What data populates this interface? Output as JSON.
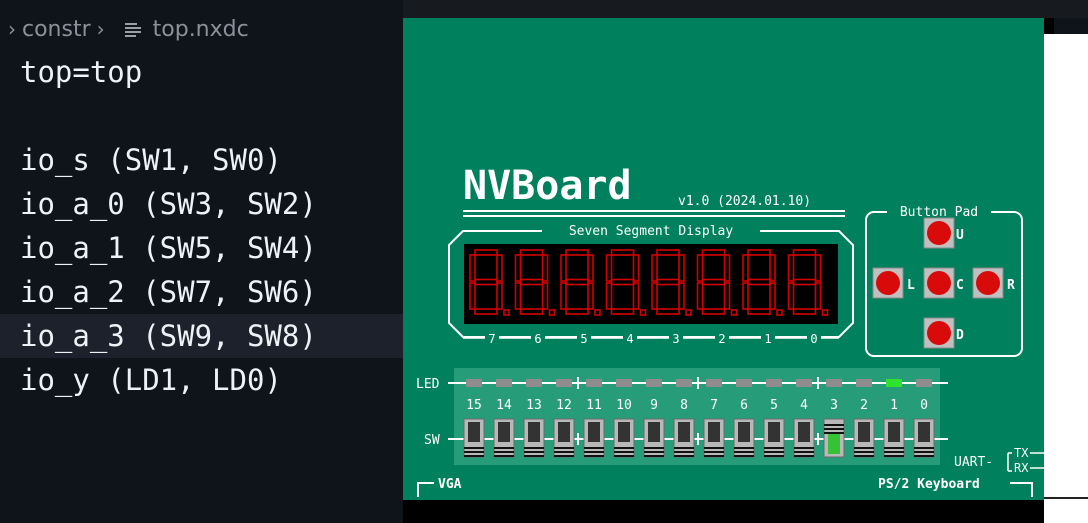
{
  "editor": {
    "breadcrumb": {
      "folder": "constr",
      "file": "top.nxdc"
    },
    "lines": [
      "top=top",
      "",
      "io_s (SW1, SW0)",
      "io_a_0 (SW3, SW2)",
      "io_a_1 (SW5, SW4)",
      "io_a_2 (SW7, SW6)",
      "io_a_3 (SW9, SW8)",
      "io_y (LD1, LD0)"
    ],
    "highlighted_line": 6
  },
  "board": {
    "title": "NVBoard",
    "version": "v1.0 (2024.01.10)",
    "seg_label": "Seven Segment Display",
    "seg_digits": [
      "7",
      "6",
      "5",
      "4",
      "3",
      "2",
      "1",
      "0"
    ],
    "button_pad_label": "Button Pad",
    "buttons": [
      "U",
      "L",
      "C",
      "R",
      "D"
    ],
    "led_label": "LED",
    "sw_label": "SW",
    "numbers": [
      "15",
      "14",
      "13",
      "12",
      "11",
      "10",
      "9",
      "8",
      "7",
      "6",
      "5",
      "4",
      "3",
      "2",
      "1",
      "0"
    ],
    "leds_on": [
      1
    ],
    "switches_on": [
      3
    ],
    "uart_label": "UART-",
    "tx_label": "TX",
    "rx_label": "RX",
    "vga_label": "VGA",
    "ps2_label": "PS/2 Keyboard"
  },
  "colors": {
    "editor_bg": "#0f131a",
    "board_green": "#00805c",
    "panel_green": "#279c78",
    "seg_red": "#d40000",
    "button_red": "#d80a0a",
    "led_off": "#8d8d8d",
    "led_on": "#2ee22e"
  }
}
